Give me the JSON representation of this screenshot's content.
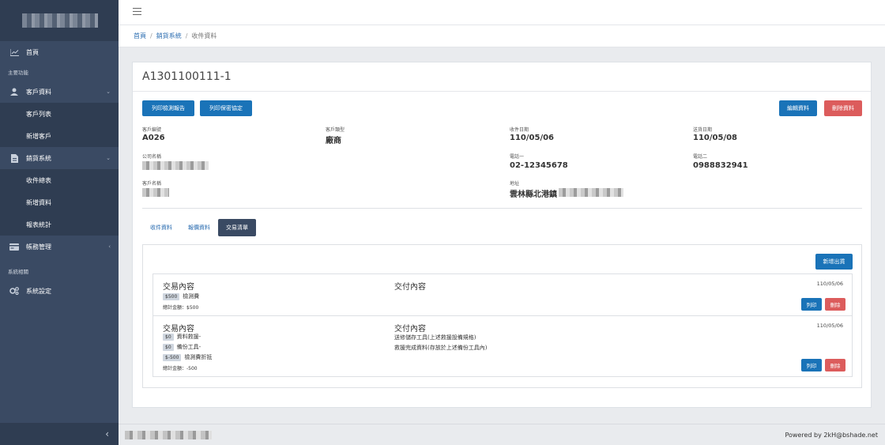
{
  "sidebar": {
    "home": "首頁",
    "section_main": "主要功能",
    "customer": "客戶資料",
    "customer_list": "客戶列表",
    "customer_new": "新增客戶",
    "sales": "銷貨系統",
    "sales_summary": "收件總表",
    "sales_new": "新增資料",
    "sales_report": "報表統計",
    "accounts": "帳務管理",
    "section_system": "系統相關",
    "settings": "系統設定",
    "collapse": "‹"
  },
  "breadcrumb": {
    "home": "首頁",
    "sales": "銷貨系統",
    "current": "收件資料"
  },
  "record": {
    "title": "A1301100111-1",
    "btn_print_report": "列印檢測報告",
    "btn_print_nda": "列印保密協定",
    "btn_edit": "編輯資料",
    "btn_delete": "刪除資料",
    "fields": {
      "customer_no_label": "客戶編號",
      "customer_no": "A026",
      "customer_type_label": "客戶類型",
      "customer_type": "廠商",
      "received_date_label": "收件日期",
      "received_date": "110/05/06",
      "sent_date_label": "送貨日期",
      "sent_date": "110/05/08",
      "company_label": "公司名稱",
      "phone1_label": "電話一",
      "phone1": "02-12345678",
      "phone2_label": "電話二",
      "phone2": "0988832941",
      "customer_name_label": "客戶名稱",
      "address_label": "地址",
      "address": "雲林縣北港鎮"
    }
  },
  "tabs": [
    "收件資料",
    "報價資料",
    "交易清單"
  ],
  "transactions": {
    "add_button": "新增出貨",
    "items": [
      {
        "content_title": "交易內容",
        "delivery_title": "交付內容",
        "date": "110/05/06",
        "lines": [
          {
            "price": "$500",
            "name": "檢測費"
          }
        ],
        "deliveries": [],
        "total": "總計金額：$500",
        "print": "列印",
        "delete": "刪除"
      },
      {
        "content_title": "交易內容",
        "delivery_title": "交付內容",
        "date": "110/05/06",
        "lines": [
          {
            "price": "$0",
            "name": "資料救援-"
          },
          {
            "price": "$0",
            "name": "備份工具-"
          },
          {
            "price": "$-500",
            "name": "檢測費折抵"
          }
        ],
        "deliveries": [
          "送修儲存工具(上述救援設備規格)",
          "救援完成資料(存放於上述備份工具內)"
        ],
        "total": "總計金額：-500",
        "print": "列印",
        "delete": "刪除"
      }
    ]
  },
  "footer": {
    "powered": "Powered by 2kH@bshade.net"
  }
}
